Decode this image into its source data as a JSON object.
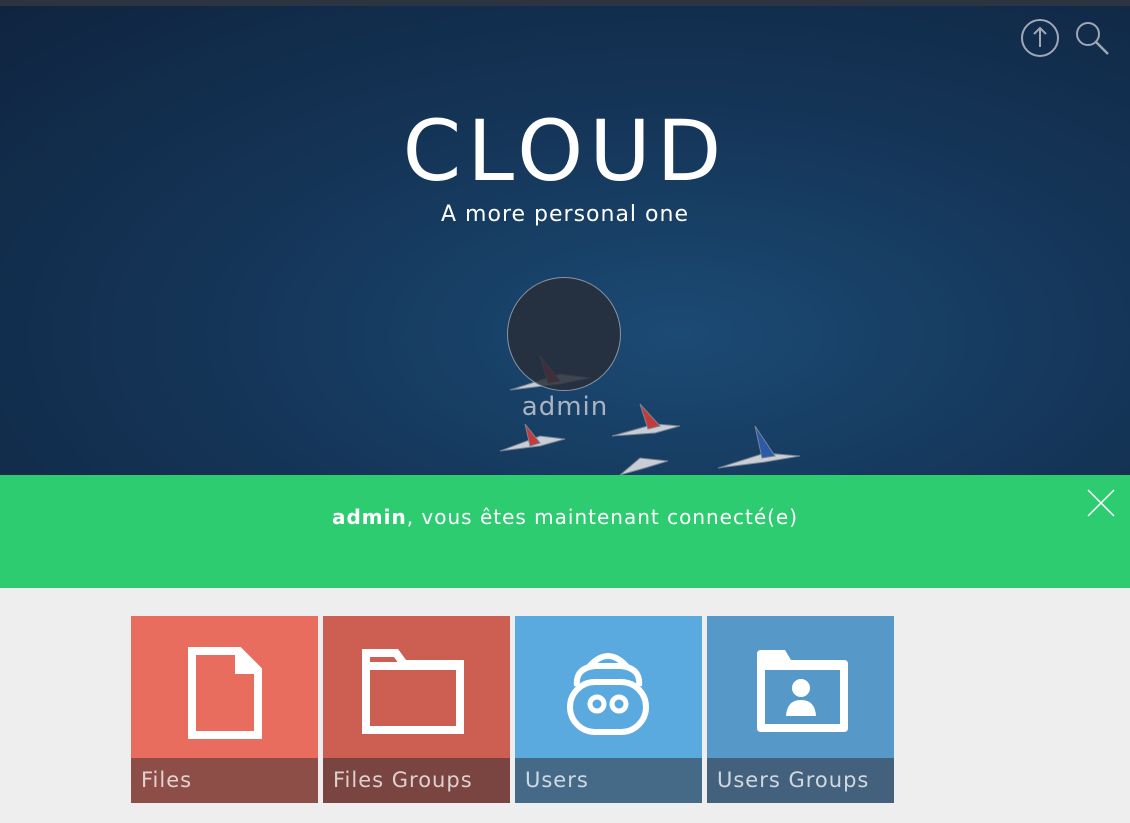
{
  "header": {
    "upload_icon": "upload-icon",
    "search_icon": "search-icon"
  },
  "hero": {
    "title": "CLOUD",
    "subtitle": "A more personal one",
    "user": "admin"
  },
  "alert": {
    "username": "admin",
    "message": ", vous êtes maintenant connecté(e)",
    "close_icon": "close-icon",
    "color": "#2ecc71"
  },
  "tiles": [
    {
      "label": "Files",
      "icon": "file-icon",
      "color": "#e96d5f"
    },
    {
      "label": "Files Groups",
      "icon": "folder-icon",
      "color": "#cc5e52"
    },
    {
      "label": "Users",
      "icon": "user-face-icon",
      "color": "#5aaae0"
    },
    {
      "label": "Users Groups",
      "icon": "user-folder-icon",
      "color": "#5699c9"
    }
  ]
}
